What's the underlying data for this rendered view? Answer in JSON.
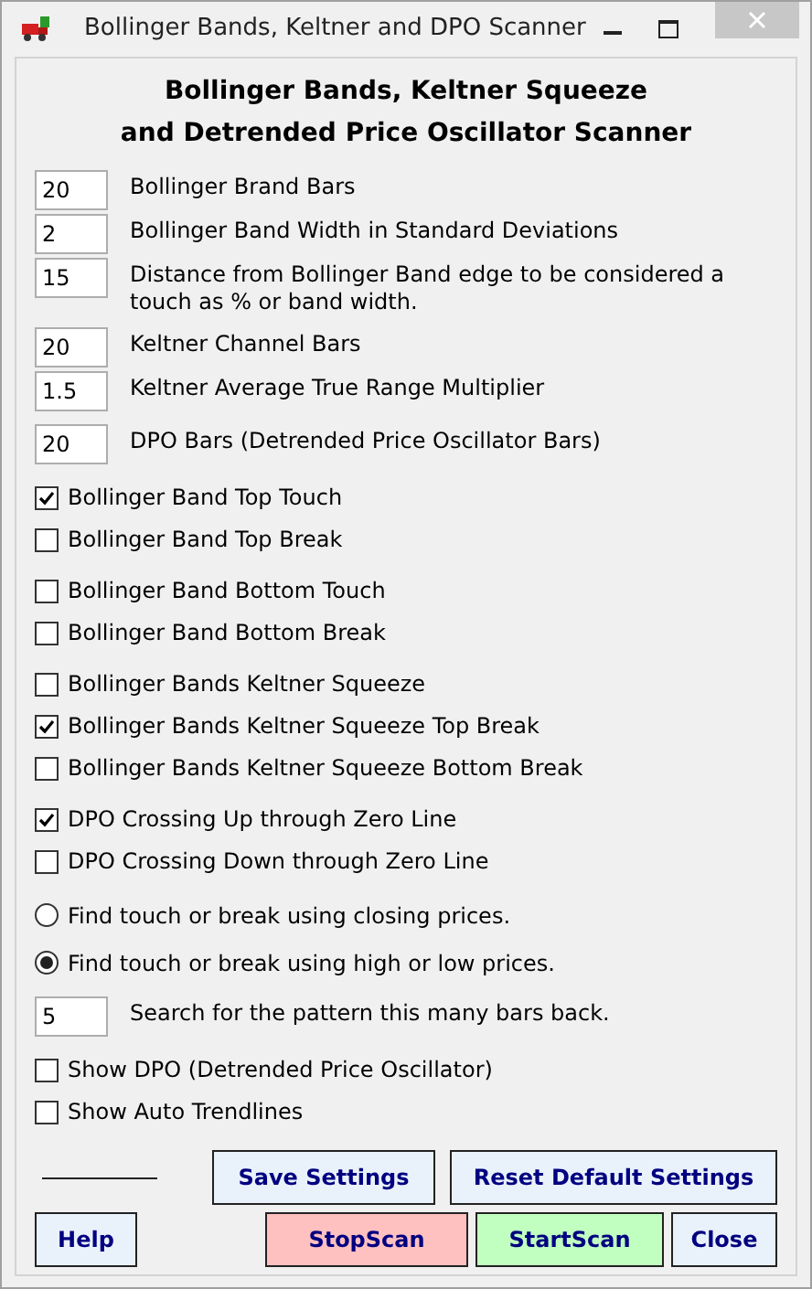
{
  "window": {
    "title": "Bollinger Bands, Keltner and DPO Scanner"
  },
  "heading": [
    "Bollinger Bands, Keltner Squeeze",
    "and Detrended Price Oscillator Scanner"
  ],
  "sections": [
    {
      "items": [
        {
          "kind": "field",
          "value": "20",
          "label": "Bollinger Brand Bars"
        },
        {
          "kind": "field",
          "value": "2",
          "label": "Bollinger Band Width in Standard Deviations"
        },
        {
          "kind": "field",
          "value": "15",
          "label": "Distance from Bollinger Band edge to be considered a touch as % or band width."
        }
      ]
    },
    {
      "items": [
        {
          "kind": "field",
          "value": "20",
          "label": "Keltner Channel Bars"
        },
        {
          "kind": "field",
          "value": "1.5",
          "label": "Keltner Average True Range Multiplier"
        }
      ]
    },
    {
      "items": [
        {
          "kind": "field",
          "value": "20",
          "label": "DPO Bars (Detrended Price Oscillator Bars)"
        }
      ]
    },
    {
      "items": [
        {
          "kind": "check",
          "label": "Bollinger Band Top Touch",
          "checked": true
        },
        {
          "kind": "check",
          "label": "Bollinger Band Top Break",
          "checked": false
        }
      ]
    },
    {
      "items": [
        {
          "kind": "check",
          "label": "Bollinger Band Bottom Touch",
          "checked": false
        },
        {
          "kind": "check",
          "label": "Bollinger Band Bottom Break",
          "checked": false
        }
      ]
    },
    {
      "items": [
        {
          "kind": "check",
          "label": "Bollinger Bands Keltner Squeeze",
          "checked": false
        },
        {
          "kind": "check",
          "label": "Bollinger Bands Keltner Squeeze Top Break",
          "checked": true
        },
        {
          "kind": "check",
          "label": "Bollinger Bands Keltner Squeeze Bottom Break",
          "checked": false
        }
      ]
    },
    {
      "items": [
        {
          "kind": "check",
          "label": "DPO Crossing Up through Zero Line",
          "checked": true
        },
        {
          "kind": "check",
          "label": "DPO Crossing Down through Zero Line",
          "checked": false
        }
      ]
    },
    {
      "items": [
        {
          "kind": "radio",
          "label": "Find touch or break using closing prices.",
          "selected": false
        },
        {
          "kind": "radio",
          "label": "Find touch or break using high or low prices.",
          "selected": true
        }
      ]
    },
    {
      "items": [
        {
          "kind": "field",
          "value": "5",
          "label": "Search for the pattern this many bars back."
        }
      ]
    },
    {
      "items": [
        {
          "kind": "check",
          "label": "Show DPO (Detrended Price Oscillator)",
          "checked": false
        },
        {
          "kind": "check",
          "label": "Show Auto Trendlines",
          "checked": false
        }
      ]
    }
  ],
  "buttons_row1": [
    {
      "label": "Save Settings",
      "kind": "plain"
    },
    {
      "label": "Reset Default Settings",
      "kind": "plain"
    }
  ],
  "buttons_row2": [
    {
      "label": "Help",
      "kind": "plain"
    },
    {
      "label": "StopScan",
      "kind": "stop"
    },
    {
      "label": "StartScan",
      "kind": "start"
    },
    {
      "label": "Close",
      "kind": "plain"
    }
  ]
}
